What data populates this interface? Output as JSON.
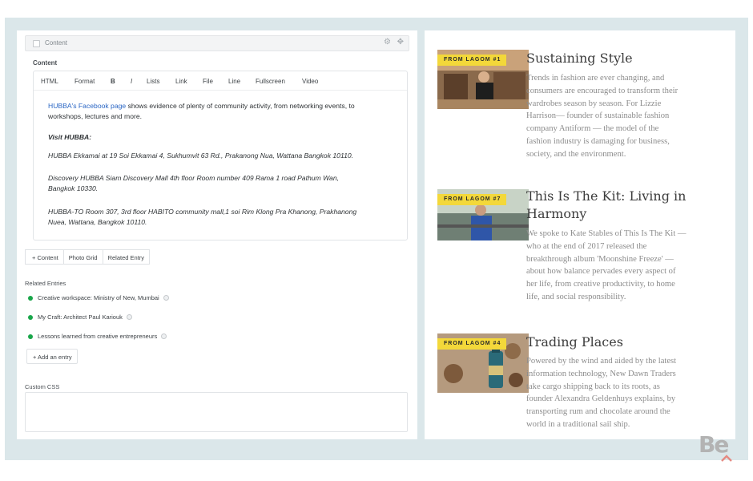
{
  "cms": {
    "field_title": "Content",
    "content_label": "Content",
    "toolbar": [
      "HTML",
      "Format",
      "B",
      "I",
      "Lists",
      "Link",
      "File",
      "Line",
      "Fullscreen",
      "Video"
    ],
    "body": {
      "p1_link": "HUBBA's Facebook page",
      "p1_rest": " shows evidence of plenty of community activity, from networking events, to",
      "p1_line2": "workshops, lectures and more.",
      "visit": "Visit HUBBA:",
      "p2": "HUBBA Ekkamai at 19 Soi Ekkamai 4, Sukhumvit 63 Rd., Prakanong Nua, Wattana Bangkok 10110.",
      "p3_line1": "Discovery HUBBA Siam Discovery Mall 4th floor Room number 409 Rama 1 road Pathum Wan,",
      "p3_line2": "Bangkok 10330.",
      "p4_line1": "HUBBA-TO Room 307, 3rd floor HABITO community mall,1 soi Rim Klong Pra Khanong, Prakhanong",
      "p4_line2": "Nuea, Wattana, Bangkok 10110."
    },
    "buttons": [
      "+ Content",
      "Photo Grid",
      "Related Entry"
    ],
    "related_label": "Related Entries",
    "related": [
      "Creative workspace: Ministry of New, Mumbai",
      "My Craft: Architect Paul Kariouk",
      "Lessons learned from creative entrepreneurs"
    ],
    "add_entry": "+ Add an entry",
    "css_label": "Custom CSS"
  },
  "articles": [
    {
      "tag": "FROM LAGOM #1",
      "title": "Sustaining Style",
      "lines": [
        "Trends in fashion are ever changing, and",
        "consumers are encouraged to transform their",
        "wardrobes season by season. For Lizzie",
        "Harrison— founder of sustainable fashion",
        "company Antiform — the model of the",
        "fashion industry is damaging for business,",
        "society, and the environment."
      ]
    },
    {
      "tag": "FROM LAGOM #7",
      "title_line1": "This Is The Kit: Living in",
      "title_line2": "Harmony",
      "lines": [
        "We spoke to Kate Stables of This Is The Kit —",
        "who at the end of 2017 released the",
        "breakthrough album 'Moonshine Freeze' —",
        "about how balance pervades every aspect of",
        "her life, from creative productivity, to home",
        "life, and social responsibility."
      ]
    },
    {
      "tag": "FROM LAGOM #4",
      "title": "Trading Places",
      "lines": [
        "Powered by the wind and aided by the latest",
        "information technology, New Dawn Traders",
        "take cargo shipping back to its roots, as",
        "founder Alexandra Geldenhuys explains, by",
        "transporting rum and chocolate around the",
        "world in a traditional sail ship."
      ]
    }
  ],
  "watermark": "Be"
}
